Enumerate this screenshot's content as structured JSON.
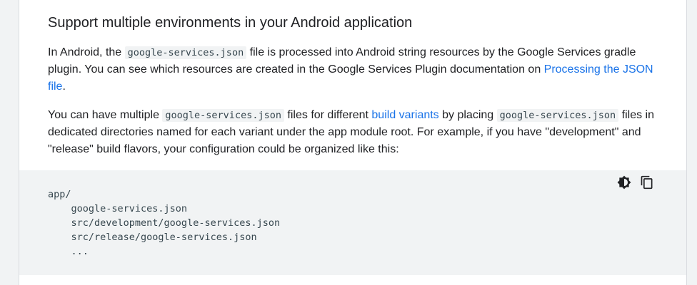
{
  "section": {
    "title": "Support multiple environments in your Android application",
    "paragraph1": {
      "text_before_code": "In Android, the ",
      "code": "google-services.json",
      "text_after_code": " file is processed into Android string resources by the Google Services gradle plugin. You can see which resources are created in the Google Services Plugin documentation on ",
      "link": "Processing the JSON file",
      "text_end": "."
    },
    "paragraph2": {
      "text_1": "You can have multiple ",
      "code_1": "google-services.json",
      "text_2": " files for different ",
      "link": "build variants",
      "text_3": " by placing ",
      "code_2": "google-services.json",
      "text_4": " files in dedicated directories named for each variant under the app module root. For example, if you have \"development\" and \"release\" build flavors, your configuration could be organized like this:"
    }
  },
  "code_block": {
    "lines": "app/\n    google-services.json\n    src/development/google-services.json\n    src/release/google-services.json\n    ...",
    "toolbar": {
      "theme_icon": "brightness-icon",
      "copy_icon": "copy-icon"
    }
  },
  "colors": {
    "link": "#1a73e8",
    "text": "#202124",
    "code_bg": "#f1f3f4"
  }
}
